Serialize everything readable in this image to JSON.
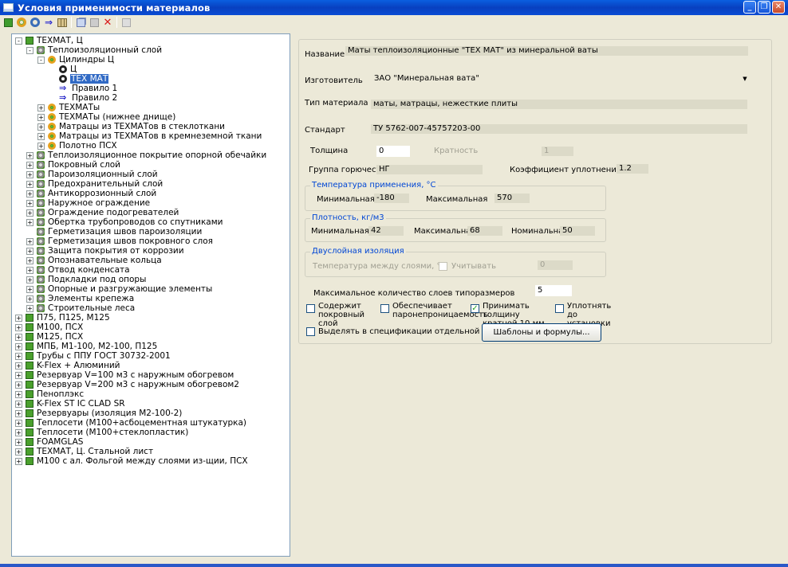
{
  "window": {
    "title": "Условия применимости материалов",
    "buttons": [
      "_",
      "❐",
      "✕"
    ]
  },
  "toolbar": {
    "icons": [
      "new-material-icon",
      "add-ring-icon",
      "add-circle-icon",
      "add-rule-icon",
      "grid-icon",
      "copy-icon",
      "paste-icon",
      "delete-icon",
      "save-icon"
    ]
  },
  "tree": [
    {
      "label": "ТЕХМАТ, Ц",
      "icon": "cube",
      "level": 0,
      "exp": "-"
    },
    {
      "label": "Теплоизоляционный слой",
      "icon": "gear",
      "level": 1,
      "exp": "-"
    },
    {
      "label": "Цилиндры Ц",
      "icon": "ring",
      "level": 2,
      "exp": "-"
    },
    {
      "label": "Ц",
      "icon": "ring2",
      "level": 3,
      "exp": ""
    },
    {
      "label": "ТЕХ МАТ",
      "icon": "ring2",
      "level": 3,
      "exp": "",
      "selected": true
    },
    {
      "label": "Правило 1",
      "icon": "arrow",
      "level": 3,
      "exp": ""
    },
    {
      "label": "Правило 2",
      "icon": "arrow",
      "level": 3,
      "exp": ""
    },
    {
      "label": "ТЕХМАТы",
      "icon": "ring",
      "level": 2,
      "exp": "+"
    },
    {
      "label": "ТЕХМАТы (нижнее днище)",
      "icon": "ring",
      "level": 2,
      "exp": "+"
    },
    {
      "label": "Матрацы из ТЕХМАТов в стеклоткани",
      "icon": "ring",
      "level": 2,
      "exp": "+"
    },
    {
      "label": "Матрацы из ТЕХМАТов в кремнеземной ткани",
      "icon": "ring",
      "level": 2,
      "exp": "+"
    },
    {
      "label": "Полотно ПСХ",
      "icon": "ring",
      "level": 2,
      "exp": "+"
    },
    {
      "label": "Теплоизоляционное покрытие опорной обечайки",
      "icon": "gear",
      "level": 1,
      "exp": "+"
    },
    {
      "label": "Покровный слой",
      "icon": "gear",
      "level": 1,
      "exp": "+"
    },
    {
      "label": "Пароизоляционный слой",
      "icon": "gear",
      "level": 1,
      "exp": "+"
    },
    {
      "label": "Предохранительный слой",
      "icon": "gear",
      "level": 1,
      "exp": "+"
    },
    {
      "label": "Антикоррозионный слой",
      "icon": "gear",
      "level": 1,
      "exp": "+"
    },
    {
      "label": "Наружное ограждение",
      "icon": "gear",
      "level": 1,
      "exp": "+"
    },
    {
      "label": "Ограждение подогревателей",
      "icon": "gear",
      "level": 1,
      "exp": "+"
    },
    {
      "label": "Обертка трубопроводов со спутниками",
      "icon": "gear",
      "level": 1,
      "exp": "+"
    },
    {
      "label": "Герметизация швов пароизоляции",
      "icon": "gear",
      "level": 1,
      "exp": ""
    },
    {
      "label": "Герметизация швов покровного слоя",
      "icon": "gear",
      "level": 1,
      "exp": "+"
    },
    {
      "label": "Защита покрытия от коррозии",
      "icon": "gear",
      "level": 1,
      "exp": "+"
    },
    {
      "label": "Опознавательные кольца",
      "icon": "gear",
      "level": 1,
      "exp": "+"
    },
    {
      "label": "Отвод конденсата",
      "icon": "gear",
      "level": 1,
      "exp": "+"
    },
    {
      "label": "Подкладки под опоры",
      "icon": "gear",
      "level": 1,
      "exp": "+"
    },
    {
      "label": "Опорные и разгружающие элементы",
      "icon": "gear",
      "level": 1,
      "exp": "+"
    },
    {
      "label": "Элементы крепежа",
      "icon": "gear",
      "level": 1,
      "exp": "+"
    },
    {
      "label": "Строительные леса",
      "icon": "gear",
      "level": 1,
      "exp": "+"
    },
    {
      "label": "П75, П125, М125",
      "icon": "cube",
      "level": 0,
      "exp": "+"
    },
    {
      "label": "М100, ПСХ",
      "icon": "cube",
      "level": 0,
      "exp": "+"
    },
    {
      "label": "М125, ПСХ",
      "icon": "cube",
      "level": 0,
      "exp": "+"
    },
    {
      "label": "МПБ, М1-100, М2-100, П125",
      "icon": "cube",
      "level": 0,
      "exp": "+"
    },
    {
      "label": "Трубы с ППУ ГОСТ 30732-2001",
      "icon": "cube",
      "level": 0,
      "exp": "+"
    },
    {
      "label": "K-Flex + Алюминий",
      "icon": "cube",
      "level": 0,
      "exp": "+"
    },
    {
      "label": "Резервуар V=100 м3 с наружным обогревом",
      "icon": "cube",
      "level": 0,
      "exp": "+"
    },
    {
      "label": "Резервуар V=200 м3 с наружным обогревом2",
      "icon": "cube",
      "level": 0,
      "exp": "+"
    },
    {
      "label": "Пеноплэкс",
      "icon": "cube",
      "level": 0,
      "exp": "+"
    },
    {
      "label": "K-Flex ST IC CLAD SR",
      "icon": "cube",
      "level": 0,
      "exp": "+"
    },
    {
      "label": "Резервуары (изоляция М2-100-2)",
      "icon": "cube",
      "level": 0,
      "exp": "+"
    },
    {
      "label": "Теплосети (М100+асбоцементная штукатурка)",
      "icon": "cube",
      "level": 0,
      "exp": "+"
    },
    {
      "label": "Теплосети (М100+стеклопластик)",
      "icon": "cube",
      "level": 0,
      "exp": "+"
    },
    {
      "label": "FOAMGLAS",
      "icon": "cube",
      "level": 0,
      "exp": "+"
    },
    {
      "label": "ТЕХМАТ, Ц. Стальной лист",
      "icon": "cube",
      "level": 0,
      "exp": "+"
    },
    {
      "label": "М100 с ал. Фольгой между слоями из-щии, ПСХ",
      "icon": "cube",
      "level": 0,
      "exp": "+"
    }
  ],
  "form": {
    "name_label": "Название",
    "name_value": "Маты теплоизоляционные \"ТЕХ МАТ\" из минеральной ваты",
    "manufacturer_label": "Изготовитель",
    "manufacturer_value": "ЗАО \"Минеральная вата\"",
    "type_label": "Тип материала",
    "type_value": "маты, матрацы, нежесткие плиты",
    "standard_label": "Стандарт",
    "standard_value": "ТУ 5762-007-45757203-00",
    "thickness_label": "Толщина",
    "thickness_value": "0",
    "multiplicity_label": "Кратность",
    "multiplicity_value": "1",
    "flammability_label": "Группа горючести",
    "flammability_value": "НГ",
    "compaction_label": "Коэффициент уплотнения",
    "compaction_value": "1.2",
    "temp_group": "Температура применения, °C",
    "temp_min_label": "Минимальная",
    "temp_min_value": "-180",
    "temp_max_label": "Максимальная",
    "temp_max_value": "570",
    "density_group": "Плотность, кг/м3",
    "density_min_label": "Минимальная",
    "density_min_value": "42",
    "density_max_label": "Максимальная",
    "density_max_value": "68",
    "density_nom_label": "Номинальная",
    "density_nom_value": "50",
    "double_group": "Двуслойная изоляция",
    "interlayer_label": "Температура между слоями, °C",
    "account_label": "Учитывать",
    "interlayer_value": "0",
    "maxlayers_label": "Максимальное количество слоев типоразмеров",
    "maxlayers_value": "5",
    "cb_cover": "Содержит покровный слой",
    "cb_vapor": "Обеспечивает паронепроницаемость",
    "cb_thick": "Принимать толщину кратной 10 мм",
    "cb_compact": "Уплотнять до установки",
    "cb_separate": "Выделять в спецификации отдельной группой",
    "templates_button": "Шаблоны и формулы..."
  }
}
